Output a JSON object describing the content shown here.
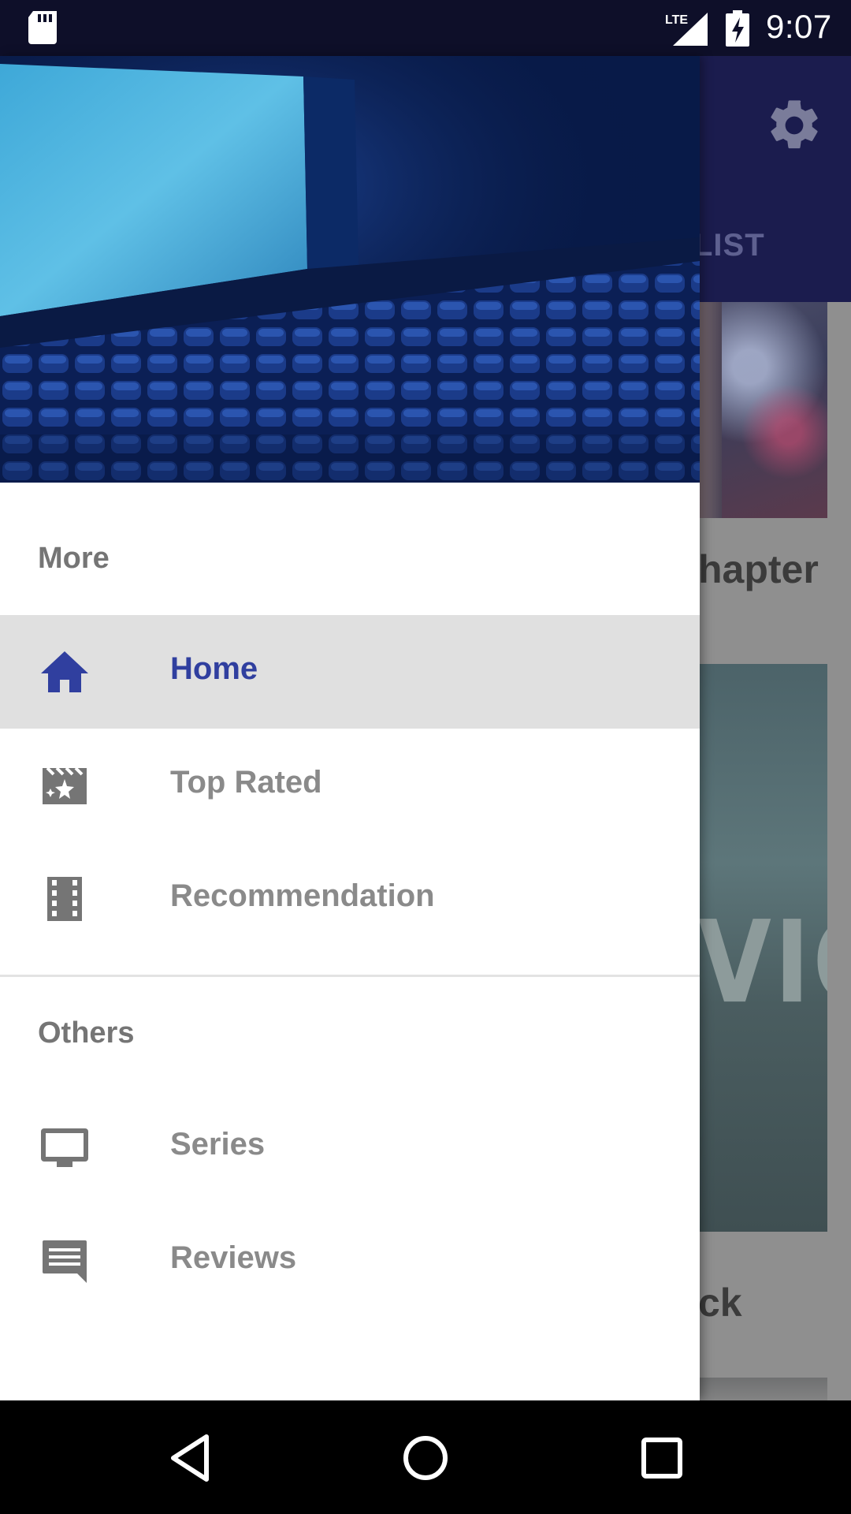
{
  "status_bar": {
    "time": "9:07",
    "network": "LTE",
    "icons": [
      "sd-card-icon",
      "lte-signal-icon",
      "battery-charging-icon"
    ]
  },
  "background_app": {
    "tab_visible_text": "LIST",
    "cards": [
      {
        "title_visible": "hapter"
      },
      {
        "poster_word_visible": "VICK",
        "title_visible": "ck"
      }
    ],
    "toolbar_color": "#1b1c4e"
  },
  "drawer": {
    "header_image": "movie-theater-image",
    "sections": [
      {
        "title": "More",
        "items": [
          {
            "label": "Home",
            "icon": "home-icon",
            "active": true
          },
          {
            "label": "Top Rated",
            "icon": "movie-star-icon",
            "active": false
          },
          {
            "label": "Recommendation",
            "icon": "film-strip-icon",
            "active": false
          }
        ]
      },
      {
        "title": "Others",
        "items": [
          {
            "label": "Series",
            "icon": "tv-icon",
            "active": false
          },
          {
            "label": "Reviews",
            "icon": "comment-icon",
            "active": false
          }
        ]
      }
    ],
    "colors": {
      "active_text": "#303f9f",
      "active_bg": "#e0e0e0",
      "inactive_text": "#8a8a8a",
      "icon_gray": "#757575"
    }
  },
  "system_nav": {
    "buttons": [
      "back-icon",
      "home-circle-icon",
      "recents-icon"
    ]
  }
}
